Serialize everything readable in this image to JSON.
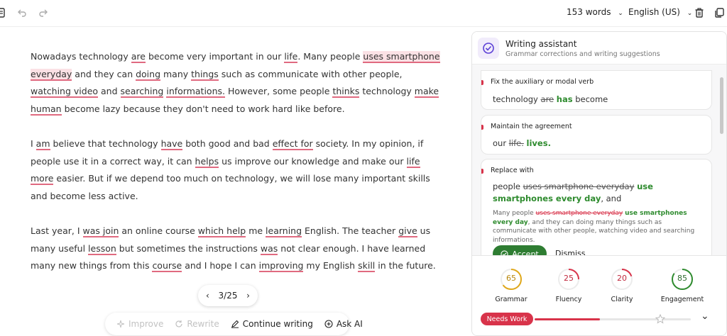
{
  "topbar": {
    "word_count": "153 words",
    "language": "English (US)"
  },
  "editor": {
    "paragraphs": [
      [
        {
          "t": "Nowadays technology "
        },
        {
          "t": "are",
          "s": "err"
        },
        {
          "t": " become very important in our "
        },
        {
          "t": "life",
          "s": "err"
        },
        {
          "t": ". Many people "
        },
        {
          "t": "uses smartphone everyday",
          "s": "hl"
        },
        {
          "t": " and they can "
        },
        {
          "t": "doing",
          "s": "err"
        },
        {
          "t": " many "
        },
        {
          "t": "things",
          "s": "err"
        },
        {
          "t": " such as communicate with other people, "
        },
        {
          "t": "watching video",
          "s": "err"
        },
        {
          "t": " and "
        },
        {
          "t": "searching",
          "s": "err"
        },
        {
          "t": " "
        },
        {
          "t": "informations.",
          "s": "err"
        },
        {
          "t": " However, some people "
        },
        {
          "t": "thinks",
          "s": "err"
        },
        {
          "t": " technology "
        },
        {
          "t": "make human",
          "s": "err"
        },
        {
          "t": " become lazy because they don't need to work hard like before."
        }
      ],
      [
        {
          "t": "I "
        },
        {
          "t": "am",
          "s": "err"
        },
        {
          "t": " believe that technology "
        },
        {
          "t": "have",
          "s": "err"
        },
        {
          "t": " both good and bad "
        },
        {
          "t": "effect for",
          "s": "err"
        },
        {
          "t": " society. In my opinion, if people use it in a correct way, it can "
        },
        {
          "t": "helps",
          "s": "err"
        },
        {
          "t": " us improve our knowledge and make our "
        },
        {
          "t": "life",
          "s": "err"
        },
        {
          "t": " "
        },
        {
          "t": "more",
          "s": "err"
        },
        {
          "t": " easier. But if we depend too much on technology, we will lose many important skills and become less active."
        }
      ],
      [
        {
          "t": "Last year, I "
        },
        {
          "t": "was join",
          "s": "err"
        },
        {
          "t": " an online course "
        },
        {
          "t": "which help",
          "s": "err"
        },
        {
          "t": " me "
        },
        {
          "t": "learning",
          "s": "err"
        },
        {
          "t": " English. The teacher "
        },
        {
          "t": "give",
          "s": "err"
        },
        {
          "t": " us many useful "
        },
        {
          "t": "lesson",
          "s": "err"
        },
        {
          "t": " but sometimes the instructions "
        },
        {
          "t": "was",
          "s": "err"
        },
        {
          "t": " not clear enough. I have learned many new things from this "
        },
        {
          "t": "course",
          "s": "err"
        },
        {
          "t": " and I hope I can "
        },
        {
          "t": "improving",
          "s": "err"
        },
        {
          "t": " my English "
        },
        {
          "t": "skill",
          "s": "err"
        },
        {
          "t": " in the future."
        }
      ]
    ]
  },
  "pager": {
    "label": "3/25"
  },
  "actions": {
    "improve": "Improve",
    "rewrite": "Rewrite",
    "continue": "Continue writing",
    "ask_ai": "Ask AI"
  },
  "panel": {
    "title": "Writing assistant",
    "subtitle": "Grammar corrections and writing suggestions",
    "cards": [
      {
        "label": "Fix the auxiliary or modal verb",
        "before": "technology ",
        "removed": "are",
        "added": "has",
        "after": "become"
      },
      {
        "label": "Maintain the agreement",
        "before": "our ",
        "removed": "life.",
        "added": "lives.",
        "after": ""
      },
      {
        "label": "Replace with",
        "before": "people ",
        "removed": "uses smartphone everyday",
        "added": "use smartphones every day",
        "after": ", and",
        "preview_before": "Many people ",
        "preview_removed": "uses smartphone everyday",
        "preview_added": "use smartphones every day",
        "preview_after": ", and they can doing many things such as communicate with other people, watching video and searching informations.",
        "accept": "Accept",
        "dismiss": "Dismiss"
      }
    ],
    "scores": [
      {
        "label": "Grammar",
        "value": "65",
        "fraction": 0.65,
        "color": "#e0a81a"
      },
      {
        "label": "Fluency",
        "value": "25",
        "fraction": 0.25,
        "color": "#d8334a"
      },
      {
        "label": "Clarity",
        "value": "20",
        "fraction": 0.2,
        "color": "#d8334a"
      },
      {
        "label": "Engagement",
        "value": "85",
        "fraction": 0.85,
        "color": "#2e8b2e"
      }
    ],
    "status_badge": "Needs Work",
    "progress_fraction": 0.42
  }
}
